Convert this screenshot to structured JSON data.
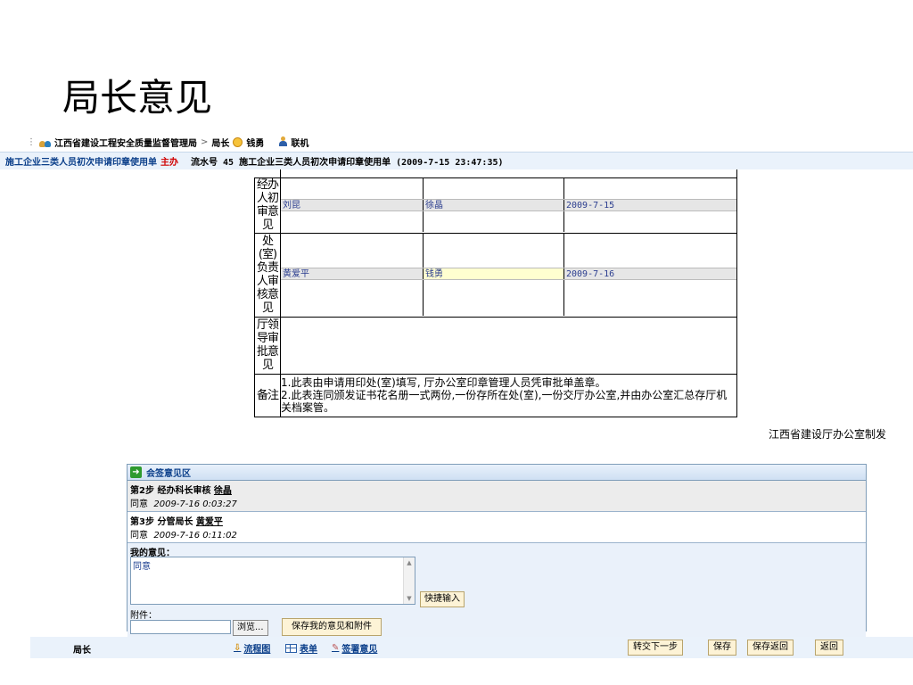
{
  "slide": {
    "title": "局长意见"
  },
  "breadcrumb": {
    "org": "江西省建设工程安全质量监督管理局",
    "sep": ">",
    "role": "局长",
    "user": "钱勇",
    "status": "联机"
  },
  "doc_bar": {
    "doc_name": "施工企业三类人员初次申请印章使用单",
    "doc_role": "主办",
    "serial_text": "流水号 45 施工企业三类人员初次申请印章使用单 (2009-7-15 23:47:35)"
  },
  "form": {
    "row1": {
      "label": "经办人初审意见",
      "name": "刘昆",
      "signer": "徐晶",
      "date": "2009-7-15"
    },
    "row2": {
      "label": "处(室)负责人审核意见",
      "name": "黄爱平",
      "signer": "钱勇",
      "date": "2009-7-16"
    },
    "row3": {
      "label": "厅领导审批意见"
    },
    "notes": {
      "label": "备注",
      "line1": "1.此表由申请用印处(室)填写, 厅办公室印章管理人员凭审批单盖章。",
      "line2": "2.此表连同颁发证书花名册一式两份,一份存所在处(室),一份交厅办公室,并由办公室汇总存厅机关档案管。"
    },
    "footnote": "江西省建设厅办公室制发"
  },
  "sign_panel": {
    "title": "会签意见区",
    "steps": [
      {
        "title_prefix": "第2步  经办科长审核  ",
        "person": "徐晶",
        "agree": "同意",
        "time": "2009-7-16 0:03:27"
      },
      {
        "title_prefix": "第3步  分管局长  ",
        "person": "黄爱平",
        "agree": "同意",
        "time": "2009-7-16 0:11:02"
      }
    ],
    "my_opinion_label": "我的意见：",
    "my_opinion_value": "同意",
    "quick_input": "快捷输入",
    "attach_label": "附件：",
    "browse": "浏览...",
    "save_opinion": "保存我的意见和附件"
  },
  "bottom_bar": {
    "role": "局长",
    "flowchart": "流程图",
    "form": "表单",
    "sign_opinion": "签署意见",
    "next_step": "转交下一步",
    "save": "保存",
    "save_return": "保存返回",
    "back": "返回"
  }
}
